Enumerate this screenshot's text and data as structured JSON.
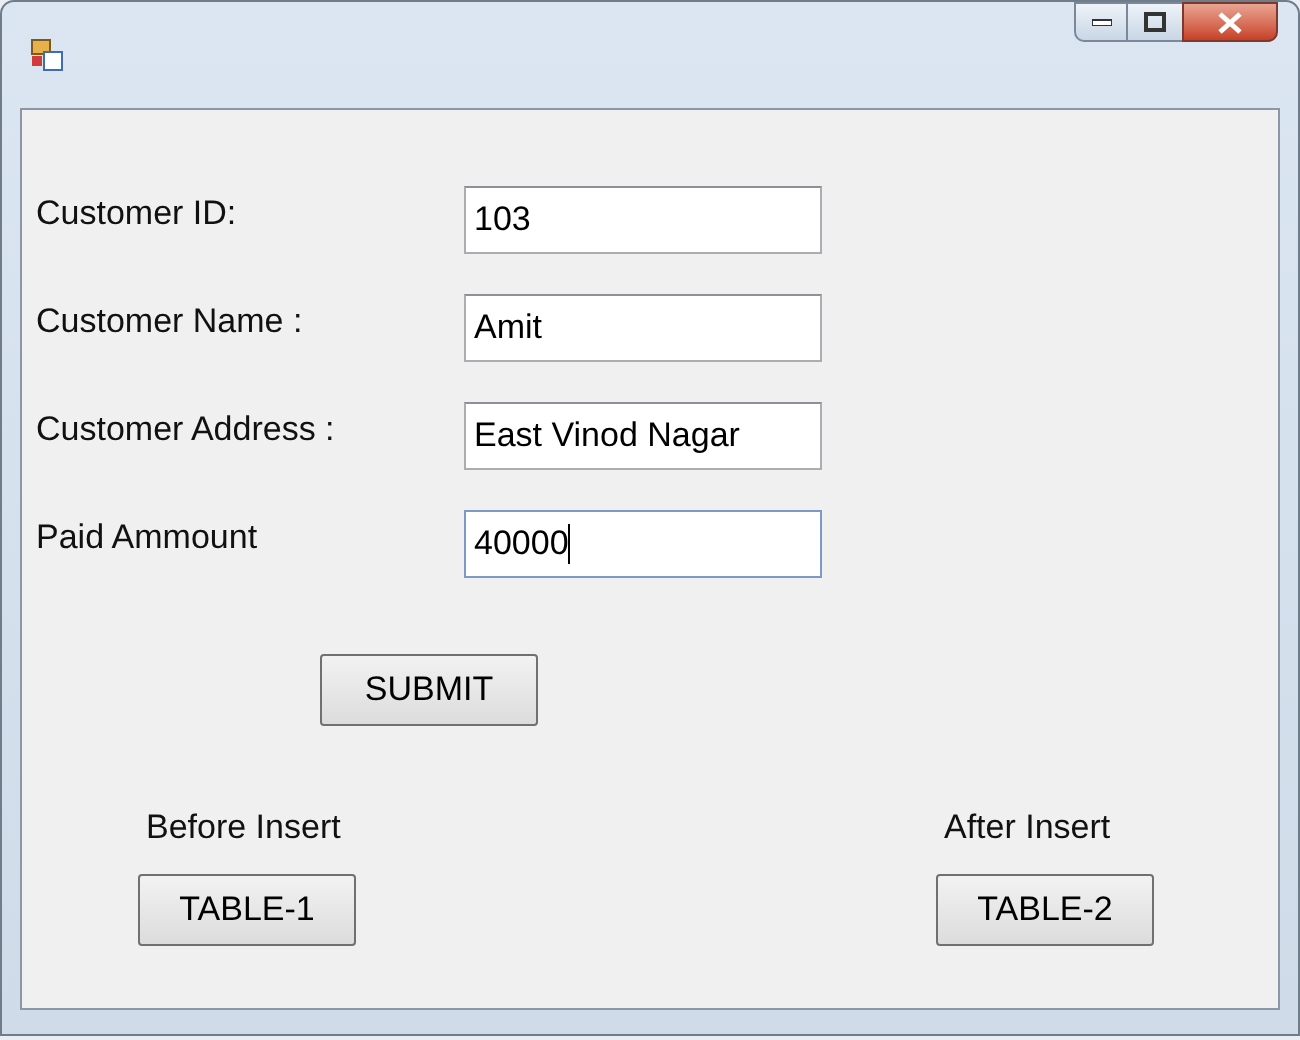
{
  "fields": [
    {
      "label": "Customer ID:",
      "value": "103",
      "focused": false
    },
    {
      "label": "Customer Name :",
      "value": "Amit",
      "focused": false
    },
    {
      "label": "Customer Address :",
      "value": "East Vinod Nagar",
      "focused": false
    },
    {
      "label": "Paid Ammount",
      "value": "40000",
      "focused": true
    }
  ],
  "submit_button": "SUBMIT",
  "tables": [
    {
      "caption": "Before Insert",
      "button": "TABLE-1"
    },
    {
      "caption": "After Insert",
      "button": "TABLE-2"
    }
  ]
}
